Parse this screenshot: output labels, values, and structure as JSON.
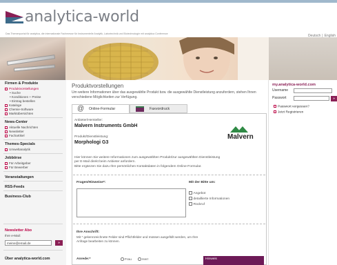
{
  "header": {
    "logo_text": "analytica-world",
    "tagline": "Das Themenportal für analytica, die internationale Fachmesse für Instrumentelle Analytik, Labortechnik und Biotechnologie mit analytica Conference",
    "lang_de": "Deutsch",
    "lang_sep": "|",
    "lang_en": "English"
  },
  "sidebar": {
    "firmen_title": "Firmen & Produkte",
    "produktvorstellungen": "Produktvorstellungen",
    "suche": "• Suche",
    "konditionen": "• Konditionen + Preise",
    "eintrag": "• Eintrag bestellen",
    "kataloge": "Kataloge",
    "chemie_software": "Chemie-Software",
    "marktuebersichten": "Marktübersichten",
    "newscenter_title": "News-Center",
    "aktuelle": "Aktuelle Nachrichten",
    "newsletter": "Newsletter",
    "fachartikel": "Fachartikel",
    "themes_title": "Themes-Specials",
    "umweltanalytik": "Umweltanalytik",
    "jobborse_title": "Jobbörse",
    "arbeitgeber": "Für Arbeitgeber",
    "bewerber": "Für Bewerber",
    "veranstaltungen": "Veranstaltungen",
    "rss": "RSS-Feeds",
    "business_club": "Business-Club",
    "newsletter_abo_title": "Newsletter Abo",
    "email_label": "Ihre e-Mail:",
    "email_value": "meine@email.de",
    "go_label": "»",
    "about": "Über analytica-world.com"
  },
  "main": {
    "page_title": "Produktvorstellungen",
    "intro": "Um weitere Informationen über das ausgewählte Produkt bzw. die ausgewählte Dienstleistung anzufordern, stehen Ihnen verschiedene Möglichkeiten zur Verfügung.",
    "tab_online": "Online-Formular",
    "tab_fax": "Faxvordruck",
    "anbieter_label": "Anbieter/Hersteller:",
    "anbieter_value": "Malvern Instruments GmbH",
    "produkt_label": "Produkt/Dienstleistung:",
    "produkt_value": "Morphologi G3",
    "malvern_logo": "Malvern",
    "desc_line1": "Hier können Sie weitere Informationen zum ausgewählten Produkt/zur ausgewählten Dienstleistung",
    "desc_line2": "per E-Mail direkt beim Anbieter anfordern.",
    "desc_line3": "Bitte ergänzen Sie dazu Ihre persönlichen Kontaktdaten in folgendem Online-Formular.",
    "fragen_label": "Fragen/Hinweise*:",
    "mit_der_bitte": "Mit der Bitte um:",
    "cb_angebot": "Angebot",
    "cb_detail": "detaillierte Informationen",
    "cb_rueckruf": "Rückruf",
    "anschrift_label": "Ihre Anschrift:",
    "note": "Mit * gekennzeichnete Felder sind Pflichtfelder und müssen ausgefüllt werden, um Ihre Anfrage bearbeiten zu können.",
    "anrede_label": "Anrede:*",
    "radio_frau": "Frau",
    "radio_herr": "Herr",
    "hinweis": "Hinweis"
  },
  "login": {
    "title": "my.analytica-world.com",
    "username_label": "Username",
    "password_label": "Passwort",
    "forgot": "Passwort vergessen?",
    "register": "Jetzt Registrieren",
    "go_label": "»"
  },
  "colors": {
    "accent": "#8a1f55",
    "link_red": "#bb0044"
  }
}
